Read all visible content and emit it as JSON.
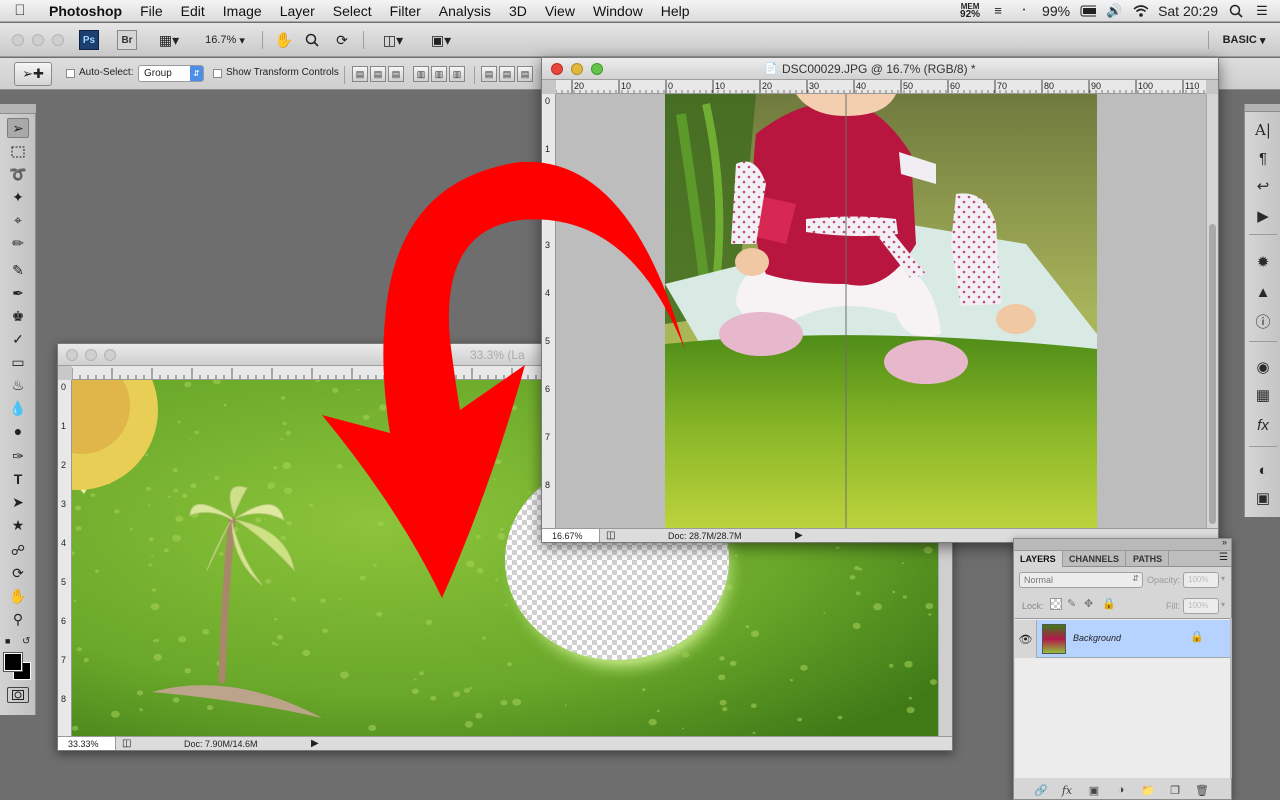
{
  "menubar": {
    "app_name": "Photoshop",
    "items": [
      "File",
      "Edit",
      "Image",
      "Layer",
      "Select",
      "Filter",
      "Analysis",
      "3D",
      "View",
      "Window",
      "Help"
    ],
    "mem_label": "MEM",
    "mem_value": "92%",
    "battery": "99%",
    "clock": "Sat 20:29"
  },
  "appbar": {
    "ps_label": "Ps",
    "br_label": "Br",
    "zoom": "16.7%",
    "workspace": "BASIC"
  },
  "options": {
    "auto_select_label": "Auto-Select:",
    "auto_select_value": "Group",
    "transform_label": "Show Transform Controls"
  },
  "doc_scene": {
    "title": "33.3% (La",
    "zoom": "33.33%",
    "doc_info": "Doc: 7.90M/14.6M",
    "ruler_v": [
      "0",
      "1",
      "2",
      "3",
      "4",
      "5",
      "6",
      "7",
      "8"
    ]
  },
  "doc_photo": {
    "title": "DSC00029.JPG @ 16.7% (RGB/8) *",
    "zoom": "16.67%",
    "doc_info": "Doc: 28.7M/28.7M",
    "ruler_h": [
      "20",
      "10",
      "0",
      "10",
      "20",
      "30",
      "40",
      "50",
      "60",
      "70",
      "80",
      "90",
      "100",
      "110"
    ],
    "ruler_v": [
      "0",
      "1",
      "2",
      "3",
      "4",
      "5",
      "6",
      "7",
      "8"
    ]
  },
  "layers_panel": {
    "tabs": [
      "LAYERS",
      "CHANNELS",
      "PATHS"
    ],
    "blend_mode": "Normal",
    "opacity_label": "Opacity:",
    "opacity_value": "100%",
    "lock_label": "Lock:",
    "fill_label": "Fill:",
    "fill_value": "100%",
    "layer_name": "Background"
  },
  "colors": {
    "accent_red_arrow": "#ff0000",
    "selected_layer": "#b6d3ff",
    "ps_logo_bg": "#1d3f70"
  }
}
